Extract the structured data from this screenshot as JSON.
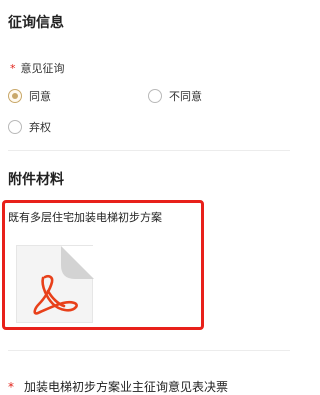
{
  "sections": {
    "consult_info_title": "征询信息",
    "attachments_title": "附件材料"
  },
  "opinion": {
    "required_mark": "*",
    "label": "意见征询",
    "options": [
      {
        "label": "同意",
        "selected": true
      },
      {
        "label": "不同意",
        "selected": false
      },
      {
        "label": "弃权",
        "selected": false
      }
    ]
  },
  "attachment": {
    "name": "既有多层住宅加装电梯初步方案",
    "icon": "pdf-icon"
  },
  "ballot": {
    "required_mark": "*",
    "label": "加装电梯初步方案业主征询意见表决票"
  },
  "colors": {
    "accent": "#c9a86a",
    "required": "#e2231a",
    "highlight_border": "#e8201a",
    "pdf_red": "#e8401a"
  }
}
